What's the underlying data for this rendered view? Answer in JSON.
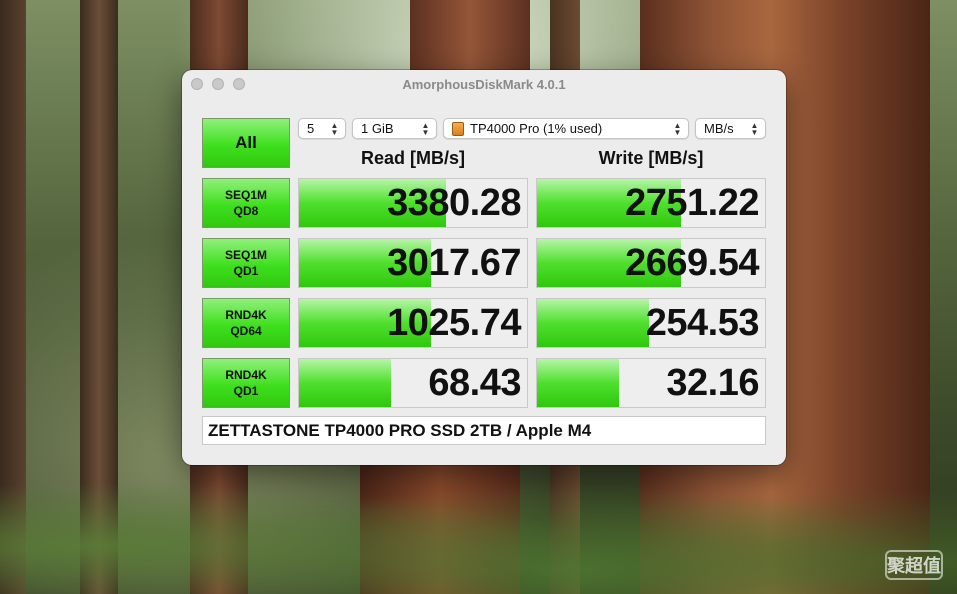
{
  "window": {
    "title": "AmorphousDiskMark 4.0.1"
  },
  "toolbar": {
    "all_label": "All",
    "count": "5",
    "size": "1 GiB",
    "drive": "TP4000 Pro (1% used)",
    "unit": "MB/s"
  },
  "headers": {
    "read": "Read [MB/s]",
    "write": "Write [MB/s]"
  },
  "tests": [
    {
      "line1": "SEQ1M",
      "line2": "QD8",
      "read": "3380.28",
      "write": "2751.22",
      "read_fill": 0.645,
      "write_fill": 0.63
    },
    {
      "line1": "SEQ1M",
      "line2": "QD1",
      "read": "3017.67",
      "write": "2669.54",
      "read_fill": 0.58,
      "write_fill": 0.63
    },
    {
      "line1": "RND4K",
      "line2": "QD64",
      "read": "1025.74",
      "write": "254.53",
      "read_fill": 0.58,
      "write_fill": 0.49
    },
    {
      "line1": "RND4K",
      "line2": "QD1",
      "read": "68.43",
      "write": "32.16",
      "read_fill": 0.405,
      "write_fill": 0.36
    }
  ],
  "comment": "ZETTASTONE TP4000 PRO SSD 2TB / Apple M4",
  "watermark": "聚超值",
  "colors": {
    "accent_green": "#3ee01e",
    "bar_green": "#4fe02e"
  }
}
